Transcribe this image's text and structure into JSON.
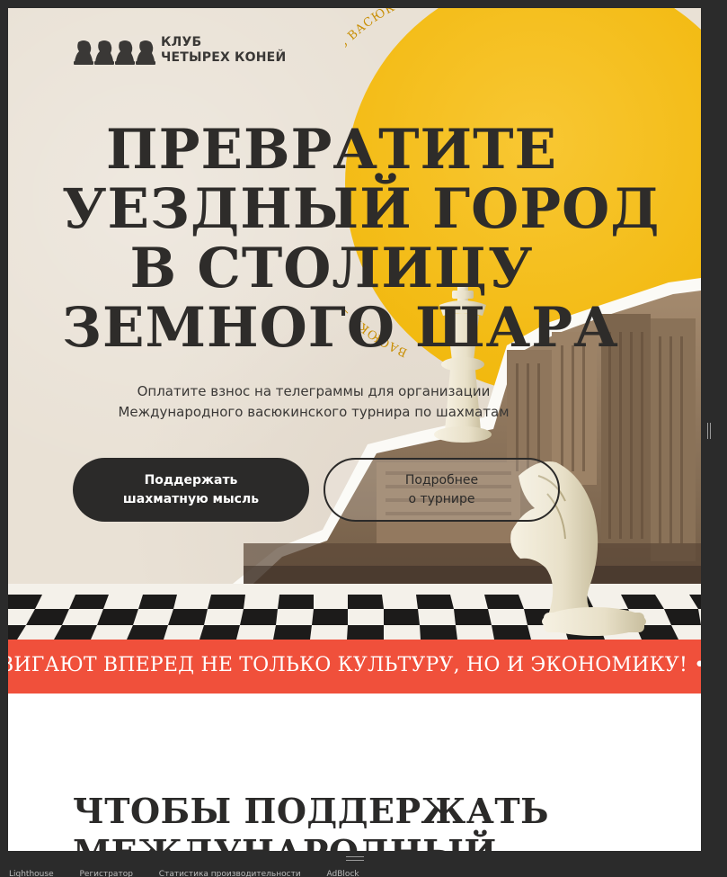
{
  "site": {
    "logo_line1": "КЛУБ",
    "logo_line2": "ЧЕТЫРЕХ КОНЕЙ",
    "sun_text": "ВАСЮКИ — НЬЮ-МОСКВА · СИГНАЛ С МАРСА · ИЗ ВАСЮКОВ"
  },
  "hero": {
    "headline": [
      "ПРЕВРАТИТЕ",
      "УЕЗДНЫЙ ГОРОД",
      "В СТОЛИЦУ",
      "ЗЕМНОГО ШАРА"
    ],
    "subtitle_line1": "Оплатите взнос на телеграммы для организации",
    "subtitle_line2": "Международного васюкинского турнира по шахматам",
    "primary_button": "Поддержать\nшахматную мысль",
    "secondary_button": "Подробнее\nо турнире"
  },
  "ticker": {
    "text": "ВИГАЮТ ВПЕРЕД НЕ ТОЛЬКО КУЛЬТУРУ, НО И ЭКОНОМИКУ!  •  ЛЕД"
  },
  "next_section": {
    "title_line1": "ЧТОБЫ ПОДДЕРЖАТЬ",
    "title_line2": "МЕЖДУНАРОДНЫЙ"
  },
  "devtools": {
    "tabs": [
      "Lighthouse",
      "Регистратор",
      "Статистика производительности",
      "AdBlock"
    ]
  },
  "colors": {
    "hero_bg": "#e9e1d5",
    "sun": "#f2b90f",
    "ticker": "#f0503b",
    "dark": "#2b2a29"
  }
}
